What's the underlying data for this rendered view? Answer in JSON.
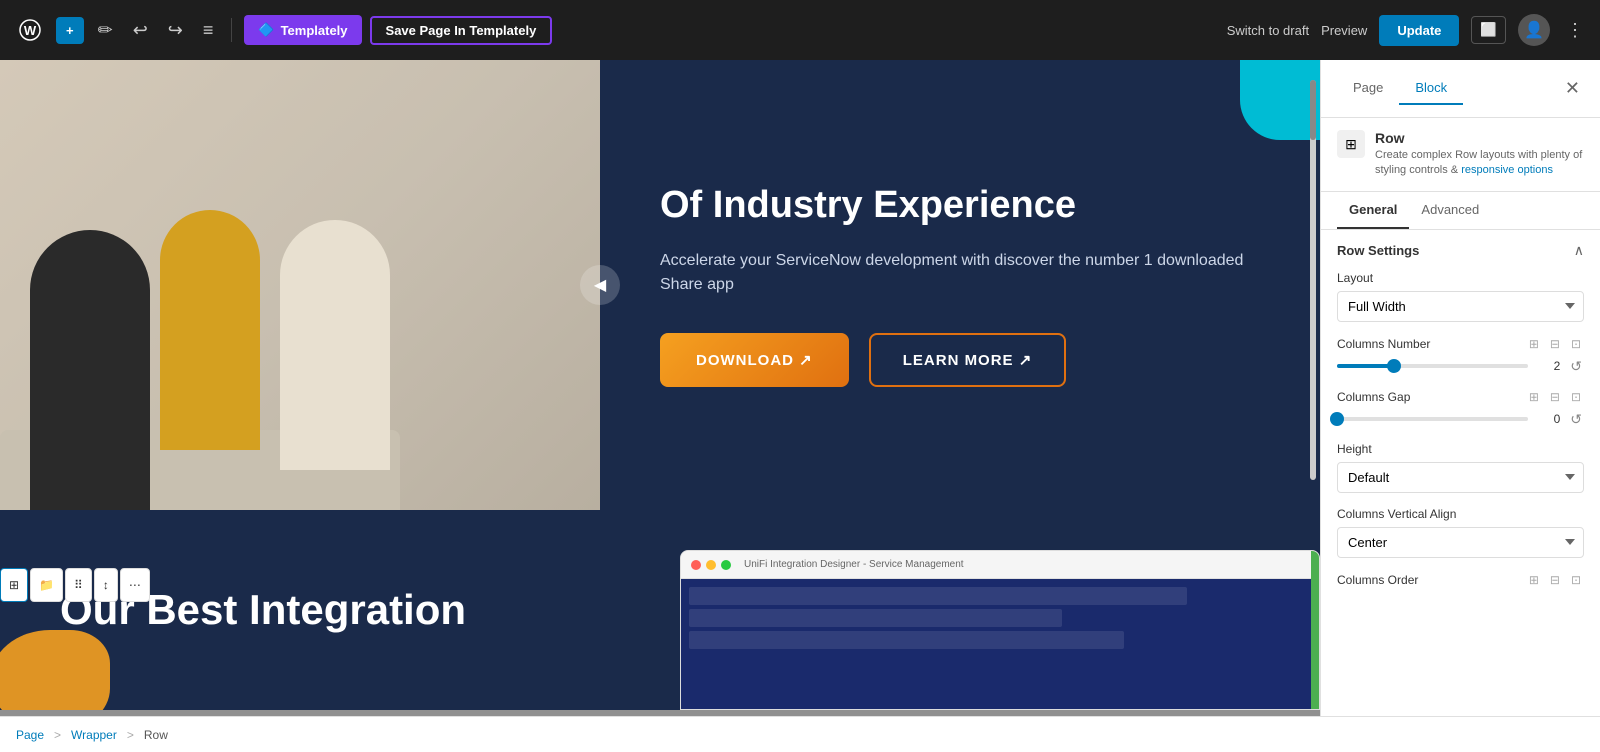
{
  "toolbar": {
    "add_label": "+",
    "pencil_icon": "✏",
    "undo_icon": "↩",
    "redo_icon": "↪",
    "dash_icon": "—",
    "templately_label": "Templately",
    "save_templately_label": "Save Page In Templately",
    "switch_draft_label": "Switch to draft",
    "preview_label": "Preview",
    "update_label": "Update",
    "view_icon": "⬜",
    "user_icon": "👤",
    "more_icon": "⋮"
  },
  "canvas": {
    "section_top": {
      "title": "Of Industry Experience",
      "description": "Accelerate your ServiceNow development with discover the number 1 downloaded Share app",
      "btn_download": "DOWNLOAD ↗",
      "btn_learn_more": "LEARN MORE ↗"
    },
    "section_bottom": {
      "title": "Our Best Integration"
    }
  },
  "right_panel": {
    "tab_page": "Page",
    "tab_block": "Block",
    "close_icon": "✕",
    "block_icon": "⊞",
    "block_name": "Row",
    "block_desc_part1": "Create complex Row layouts with plenty of styling controls &",
    "block_desc_highlight": "responsive options",
    "inner_tab_general": "General",
    "inner_tab_advanced": "Advanced",
    "row_settings_title": "Row Settings",
    "collapse_icon": "∧",
    "layout_label": "Layout",
    "layout_value": "Full Width",
    "columns_number_label": "Columns Number",
    "columns_icon1": "⊞",
    "columns_icon2": "⊟",
    "columns_icon3": "⊡",
    "columns_value": 2,
    "columns_slider_pct": 30,
    "columns_gap_label": "Columns Gap",
    "gap_icon1": "⊞",
    "gap_icon2": "⊟",
    "gap_icon3": "⊡",
    "gap_value": 0,
    "gap_slider_pct": 0,
    "height_label": "Height",
    "height_value": "Default",
    "columns_vertical_align_label": "Columns Vertical Align",
    "vertical_align_value": "Center",
    "columns_order_label": "Columns Order",
    "order_icon1": "⊞",
    "order_icon2": "⊟",
    "order_icon3": "⊡"
  },
  "status_bar": {
    "page_label": "Page",
    "sep1": ">",
    "wrapper_label": "Wrapper",
    "sep2": ">",
    "row_label": "Row"
  },
  "block_toolbar": {
    "icon1": "⊞",
    "icon2": "☰",
    "icon3": "⊞",
    "icon4": "↕",
    "icon5": "⋯"
  }
}
